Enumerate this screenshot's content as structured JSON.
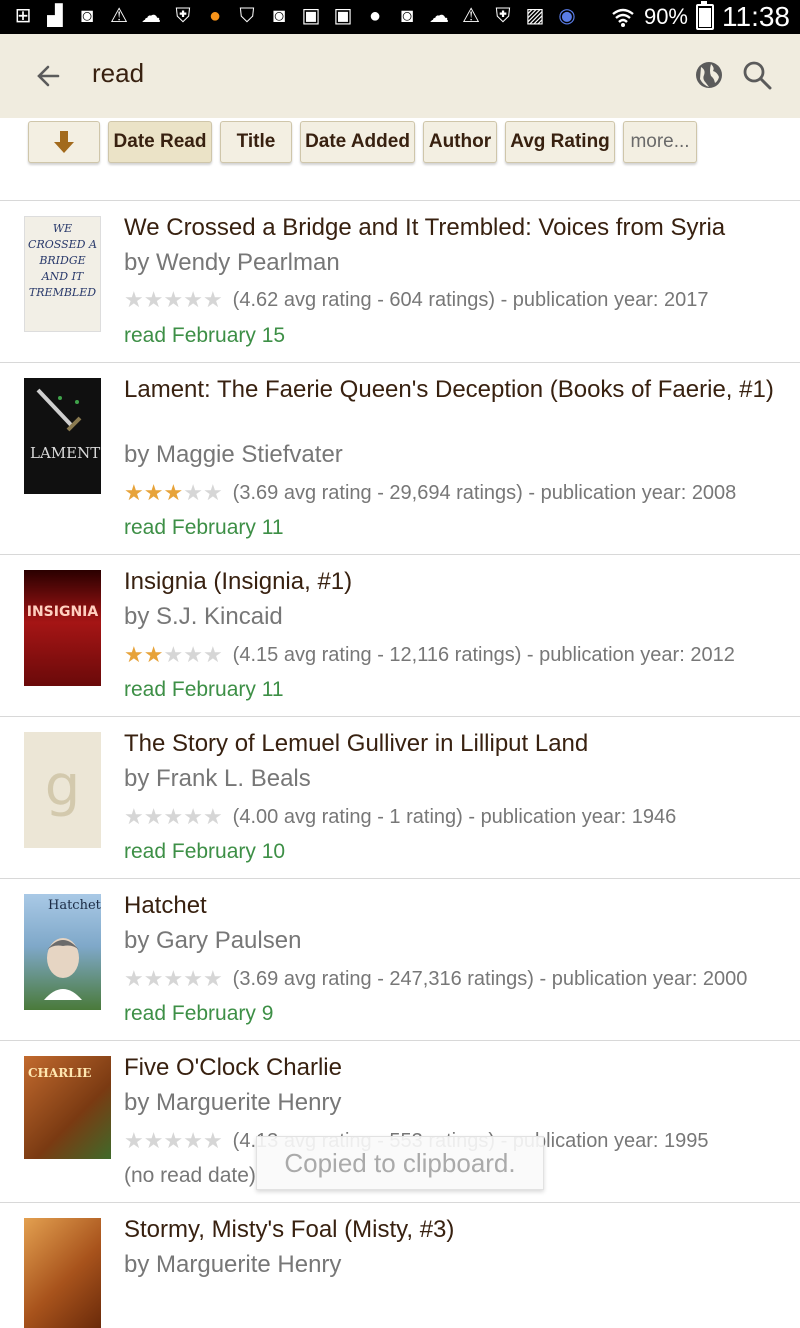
{
  "status_bar": {
    "battery_percent": "90%",
    "time": "11:38",
    "icons": [
      "plus-icon",
      "bag-icon",
      "camera-icon",
      "warning-icon",
      "bubble-icon",
      "shield-icon",
      "bitcoin-icon",
      "shield-check-icon",
      "camera-icon",
      "facebook-icon",
      "facebook-icon",
      "chat-icon",
      "camera-icon",
      "bubble-icon",
      "warning-icon",
      "shield-icon",
      "image-icon",
      "android-icon",
      "wifi-icon"
    ]
  },
  "toolbar": {
    "search_query": "read",
    "icons": {
      "back": "back-arrow-icon",
      "globe": "globe-icon",
      "search": "search-icon"
    }
  },
  "sort_bar": {
    "buttons": [
      "Date Read",
      "Title",
      "Date Added",
      "Author",
      "Avg Rating",
      "more..."
    ],
    "active": "Date Read"
  },
  "books": [
    {
      "title": "We Crossed a Bridge and It Trembled: Voices from Syria",
      "author": "by Wendy Pearlman",
      "stars": 0,
      "stats": "(4.62 avg rating - 604 ratings) - publication year: 2017",
      "read": "read February 15",
      "cover_text": "WE CROSSED A BRIDGE AND IT TREMBLED",
      "cover_bg": "#f2efe6",
      "cover_fg": "#2a3a6b"
    },
    {
      "title": "Lament: The Faerie Queen's Deception (Books of Faerie, #1)",
      "author": "by Maggie Stiefvater",
      "stars": 3,
      "stats": "(3.69 avg rating - 29,694 ratings) - publication year: 2008",
      "read": "read February 11",
      "cover_text": "LAMENT",
      "cover_bg": "#101010",
      "cover_fg": "#d9d9d9"
    },
    {
      "title": "Insignia (Insignia, #1)",
      "author": "by S.J. Kincaid",
      "stars": 2,
      "stats": "(4.15 avg rating - 12,116 ratings) - publication year: 2012",
      "read": "read February 11",
      "cover_text": "INSIGNIA",
      "cover_bg": "#8a1010",
      "cover_fg": "#ffd0c0"
    },
    {
      "title": "The Story of Lemuel Gulliver in Lilliput Land",
      "author": "by Frank L. Beals",
      "stars": 0,
      "stats": "(4.00 avg rating - 1 rating) - publication year: 1946",
      "read": "read February 10",
      "cover_text": "g",
      "cover_bg": "#ece6d6",
      "cover_fg": "#d3c9ad"
    },
    {
      "title": "Hatchet",
      "author": "by Gary Paulsen",
      "stars": 0,
      "stats": "(3.69 avg rating - 247,316 ratings) - publication year: 2000",
      "read": "read February 9",
      "cover_text": "Hatchet",
      "cover_bg": "#7fa8c9",
      "cover_fg": "#1b2b44"
    },
    {
      "title": "Five O'Clock Charlie",
      "author": "by Marguerite Henry",
      "stars": 0,
      "stats": "(4.13 avg rating - 553 ratings) - publication year: 1995",
      "read": "(no read date)",
      "cover_text": "CHARLIE",
      "cover_bg": "#9a5a2a",
      "cover_fg": "#ffe7b0"
    },
    {
      "title": "Stormy, Misty's Foal (Misty, #3)",
      "author": "by Marguerite Henry",
      "stars": 0,
      "stats": "",
      "read": "",
      "cover_text": "",
      "cover_bg": "#b86a2a",
      "cover_fg": "#ffe3b0"
    }
  ],
  "toast": "Copied to clipboard.",
  "colors": {
    "accent": "#382110",
    "read_green": "#3d8f46",
    "star_on": "#e7a33a",
    "toolbar_bg": "#f0ecdf"
  }
}
